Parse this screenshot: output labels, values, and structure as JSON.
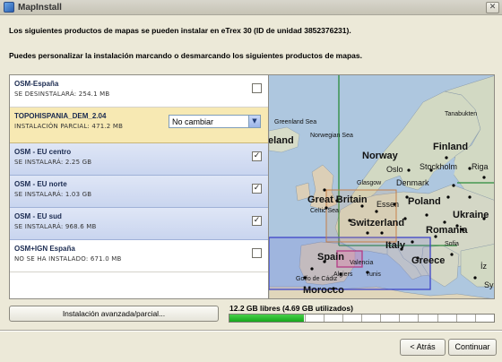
{
  "window": {
    "title": "MapInstall",
    "close_glyph": "✕"
  },
  "intro": {
    "line1": "Los siguientes productos de mapas se pueden instalar en eTrex 30 (ID de unidad 3852376231).",
    "line2": "Puedes personalizar la instalación marcando o desmarcando los siguientes productos de mapas."
  },
  "products": [
    {
      "name": "OSM-España",
      "status": "SE DESINSTALARÁ: 254.1 MB",
      "checked": false
    },
    {
      "name": "TOPOHISPANIA_DEM_2.04",
      "status": "INSTALACIÓN PARCIAL: 471.2 MB",
      "select_value": "No cambiar"
    },
    {
      "name": "OSM - EU centro",
      "status": "SE INSTALARÁ: 2.25 GB",
      "checked": true
    },
    {
      "name": "OSM - EU norte",
      "status": "SE INSTALARÁ: 1.03 GB",
      "checked": true
    },
    {
      "name": "OSM - EU sud",
      "status": "SE INSTALARÁ: 968.6 MB",
      "checked": true
    },
    {
      "name": "OSM+IGN España",
      "status": "NO SE HA INSTALADO: 671.0 MB",
      "checked": false
    }
  ],
  "map_labels": {
    "greenland_sea": "Greenland Sea",
    "tanabukten": "Tanabukten",
    "norwegian_sea": "Norwegian Sea",
    "iceland": "eland",
    "finland": "Finland",
    "norway": "Norway",
    "stockholm": "Stockholm",
    "oslo": "Oslo",
    "riga": "Riga",
    "glasgow": "Glasgow",
    "denmark": "Denmark",
    "great_britain": "Great Britain",
    "celtic_sea": "Celtic Sea",
    "essen": "Essen",
    "poland": "Poland",
    "ukraine": "Ukraine",
    "switzerland": "Switzerland",
    "romania": "Romania",
    "italy": "Italy",
    "sofia": "Sofia",
    "spain": "Spain",
    "valencia": "Valencia",
    "greece": "Greece",
    "golfo_de_cadiz": "Golfo de Cádiz",
    "algiers": "Algiers",
    "tunis": "Tunis",
    "morocco": "Morocco",
    "iz": "İz",
    "sy": "Sy"
  },
  "bottom": {
    "advanced_button": "Instalación avanzada/parcial...",
    "storage_label": "12.2 GB libres (4.69 GB utilizados)",
    "storage_used_fraction": 0.28,
    "back_button": "< Atrás",
    "next_button": "Continuar"
  },
  "colors": {
    "selected_row": "#c9d5ef",
    "highlight_row": "#f7e9b3",
    "storage_fill": "#16a71c"
  }
}
